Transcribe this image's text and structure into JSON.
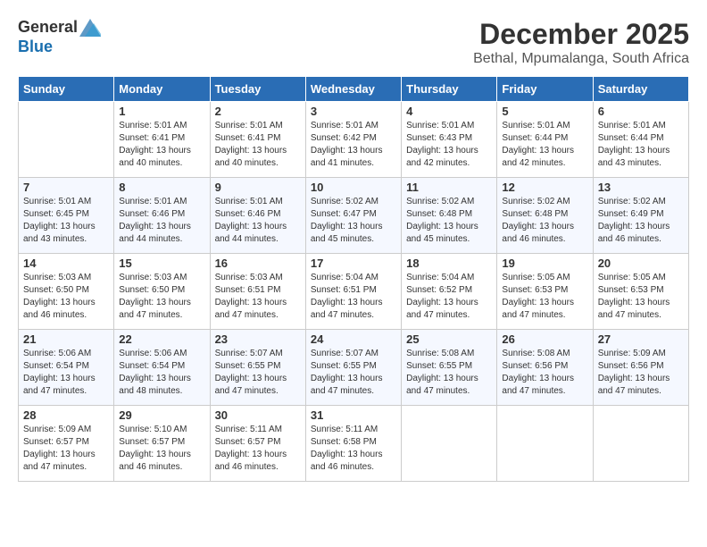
{
  "logo": {
    "text_general": "General",
    "text_blue": "Blue"
  },
  "title": "December 2025",
  "location": "Bethal, Mpumalanga, South Africa",
  "headers": [
    "Sunday",
    "Monday",
    "Tuesday",
    "Wednesday",
    "Thursday",
    "Friday",
    "Saturday"
  ],
  "weeks": [
    [
      {
        "day": "",
        "info": ""
      },
      {
        "day": "1",
        "info": "Sunrise: 5:01 AM\nSunset: 6:41 PM\nDaylight: 13 hours\nand 40 minutes."
      },
      {
        "day": "2",
        "info": "Sunrise: 5:01 AM\nSunset: 6:41 PM\nDaylight: 13 hours\nand 40 minutes."
      },
      {
        "day": "3",
        "info": "Sunrise: 5:01 AM\nSunset: 6:42 PM\nDaylight: 13 hours\nand 41 minutes."
      },
      {
        "day": "4",
        "info": "Sunrise: 5:01 AM\nSunset: 6:43 PM\nDaylight: 13 hours\nand 42 minutes."
      },
      {
        "day": "5",
        "info": "Sunrise: 5:01 AM\nSunset: 6:44 PM\nDaylight: 13 hours\nand 42 minutes."
      },
      {
        "day": "6",
        "info": "Sunrise: 5:01 AM\nSunset: 6:44 PM\nDaylight: 13 hours\nand 43 minutes."
      }
    ],
    [
      {
        "day": "7",
        "info": "Sunrise: 5:01 AM\nSunset: 6:45 PM\nDaylight: 13 hours\nand 43 minutes."
      },
      {
        "day": "8",
        "info": "Sunrise: 5:01 AM\nSunset: 6:46 PM\nDaylight: 13 hours\nand 44 minutes."
      },
      {
        "day": "9",
        "info": "Sunrise: 5:01 AM\nSunset: 6:46 PM\nDaylight: 13 hours\nand 44 minutes."
      },
      {
        "day": "10",
        "info": "Sunrise: 5:02 AM\nSunset: 6:47 PM\nDaylight: 13 hours\nand 45 minutes."
      },
      {
        "day": "11",
        "info": "Sunrise: 5:02 AM\nSunset: 6:48 PM\nDaylight: 13 hours\nand 45 minutes."
      },
      {
        "day": "12",
        "info": "Sunrise: 5:02 AM\nSunset: 6:48 PM\nDaylight: 13 hours\nand 46 minutes."
      },
      {
        "day": "13",
        "info": "Sunrise: 5:02 AM\nSunset: 6:49 PM\nDaylight: 13 hours\nand 46 minutes."
      }
    ],
    [
      {
        "day": "14",
        "info": "Sunrise: 5:03 AM\nSunset: 6:50 PM\nDaylight: 13 hours\nand 46 minutes."
      },
      {
        "day": "15",
        "info": "Sunrise: 5:03 AM\nSunset: 6:50 PM\nDaylight: 13 hours\nand 47 minutes."
      },
      {
        "day": "16",
        "info": "Sunrise: 5:03 AM\nSunset: 6:51 PM\nDaylight: 13 hours\nand 47 minutes."
      },
      {
        "day": "17",
        "info": "Sunrise: 5:04 AM\nSunset: 6:51 PM\nDaylight: 13 hours\nand 47 minutes."
      },
      {
        "day": "18",
        "info": "Sunrise: 5:04 AM\nSunset: 6:52 PM\nDaylight: 13 hours\nand 47 minutes."
      },
      {
        "day": "19",
        "info": "Sunrise: 5:05 AM\nSunset: 6:53 PM\nDaylight: 13 hours\nand 47 minutes."
      },
      {
        "day": "20",
        "info": "Sunrise: 5:05 AM\nSunset: 6:53 PM\nDaylight: 13 hours\nand 47 minutes."
      }
    ],
    [
      {
        "day": "21",
        "info": "Sunrise: 5:06 AM\nSunset: 6:54 PM\nDaylight: 13 hours\nand 47 minutes."
      },
      {
        "day": "22",
        "info": "Sunrise: 5:06 AM\nSunset: 6:54 PM\nDaylight: 13 hours\nand 48 minutes."
      },
      {
        "day": "23",
        "info": "Sunrise: 5:07 AM\nSunset: 6:55 PM\nDaylight: 13 hours\nand 47 minutes."
      },
      {
        "day": "24",
        "info": "Sunrise: 5:07 AM\nSunset: 6:55 PM\nDaylight: 13 hours\nand 47 minutes."
      },
      {
        "day": "25",
        "info": "Sunrise: 5:08 AM\nSunset: 6:55 PM\nDaylight: 13 hours\nand 47 minutes."
      },
      {
        "day": "26",
        "info": "Sunrise: 5:08 AM\nSunset: 6:56 PM\nDaylight: 13 hours\nand 47 minutes."
      },
      {
        "day": "27",
        "info": "Sunrise: 5:09 AM\nSunset: 6:56 PM\nDaylight: 13 hours\nand 47 minutes."
      }
    ],
    [
      {
        "day": "28",
        "info": "Sunrise: 5:09 AM\nSunset: 6:57 PM\nDaylight: 13 hours\nand 47 minutes."
      },
      {
        "day": "29",
        "info": "Sunrise: 5:10 AM\nSunset: 6:57 PM\nDaylight: 13 hours\nand 46 minutes."
      },
      {
        "day": "30",
        "info": "Sunrise: 5:11 AM\nSunset: 6:57 PM\nDaylight: 13 hours\nand 46 minutes."
      },
      {
        "day": "31",
        "info": "Sunrise: 5:11 AM\nSunset: 6:58 PM\nDaylight: 13 hours\nand 46 minutes."
      },
      {
        "day": "",
        "info": ""
      },
      {
        "day": "",
        "info": ""
      },
      {
        "day": "",
        "info": ""
      }
    ]
  ]
}
